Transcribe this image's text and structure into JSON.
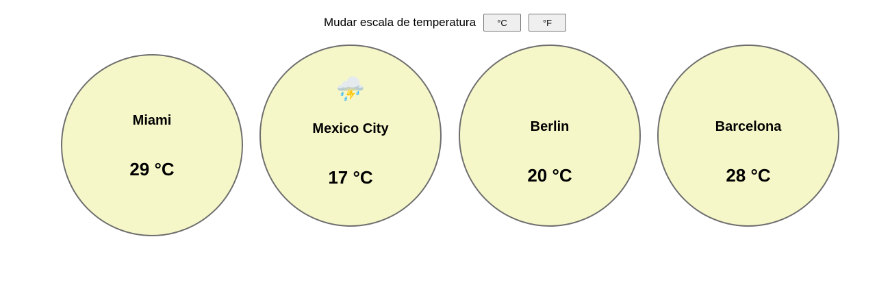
{
  "scale_control": {
    "label": "Mudar escala de temperatura",
    "celsius_label": "°C",
    "fahrenheit_label": "°F"
  },
  "cities": [
    {
      "name": "Miami",
      "temperature": "29 °C",
      "icon": ""
    },
    {
      "name": "Mexico City",
      "temperature": "17 °C",
      "icon": "⛈️"
    },
    {
      "name": "Berlin",
      "temperature": "20 °C",
      "icon": ""
    },
    {
      "name": "Barcelona",
      "temperature": "28 °C",
      "icon": ""
    }
  ],
  "colors": {
    "card_background": "#f6f7c9",
    "card_border": "#6e6e6e"
  }
}
